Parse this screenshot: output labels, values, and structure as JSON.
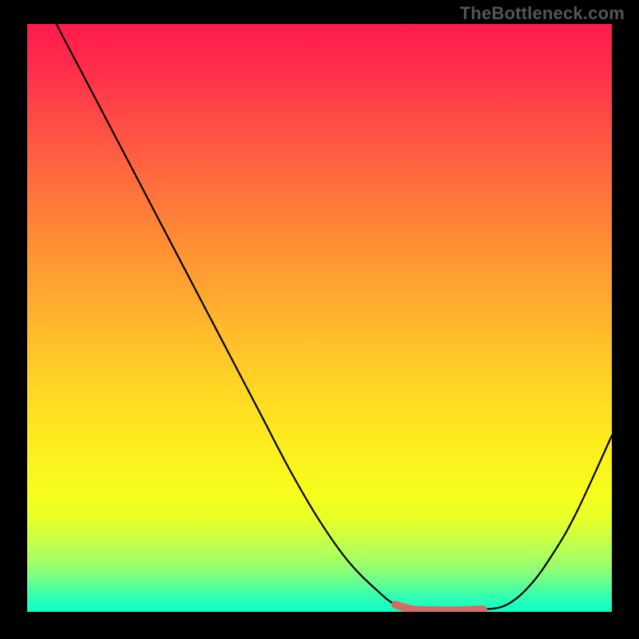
{
  "watermark": "TheBottleneck.com",
  "colors": {
    "background": "#000000",
    "curve": "#000000",
    "highlight": "#d66b63",
    "gradient_top": "#ff1a4e",
    "gradient_mid": "#ffd124",
    "gradient_bottom": "#0cffcb"
  },
  "chart_data": {
    "type": "line",
    "title": "",
    "xlabel": "",
    "ylabel": "",
    "xlim": [
      0,
      100
    ],
    "ylim": [
      0,
      100
    ],
    "grid": false,
    "series": [
      {
        "name": "bottleneck_pct",
        "x": [
          0,
          5,
          10,
          15,
          20,
          25,
          30,
          35,
          40,
          45,
          50,
          55,
          60,
          63,
          66,
          70,
          74,
          78,
          82,
          86,
          90,
          94,
          100
        ],
        "values": [
          110,
          100,
          90.5,
          81,
          71.5,
          62,
          52.5,
          43,
          33.5,
          24,
          15.5,
          8.5,
          3.5,
          1.2,
          0.4,
          0.25,
          0.25,
          0.4,
          1.2,
          4.5,
          10,
          17,
          30
        ]
      },
      {
        "name": "optimal_zone",
        "x": [
          63,
          66,
          70,
          74,
          78
        ],
        "values": [
          1.2,
          0.4,
          0.25,
          0.25,
          0.4
        ]
      }
    ]
  }
}
